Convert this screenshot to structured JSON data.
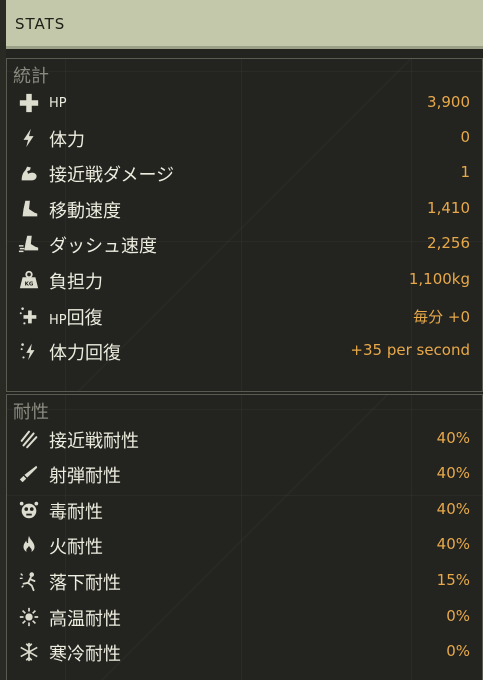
{
  "header": {
    "title": "STATS"
  },
  "sections": [
    {
      "title": "統計",
      "rows": [
        {
          "icon": "plus-icon",
          "label_prefix": "HP",
          "label": "",
          "value": "3,900"
        },
        {
          "icon": "lightning-icon",
          "label_prefix": "",
          "label": "体力",
          "value": "0"
        },
        {
          "icon": "bicep-icon",
          "label_prefix": "",
          "label": "接近戦ダメージ",
          "value": "1"
        },
        {
          "icon": "boot-icon",
          "label_prefix": "",
          "label": "移動速度",
          "value": "1,410"
        },
        {
          "icon": "dash-boot-icon",
          "label_prefix": "",
          "label": "ダッシュ速度",
          "value": "2,256"
        },
        {
          "icon": "weight-icon",
          "label_prefix": "",
          "label": "負担力",
          "value": "1,100kg"
        },
        {
          "icon": "hp-regen-icon",
          "label_prefix": "HP",
          "label": "回復",
          "value": "毎分 +0"
        },
        {
          "icon": "stamina-regen-icon",
          "label_prefix": "",
          "label": "体力回復",
          "value": "+35 per second"
        }
      ]
    },
    {
      "title": "耐性",
      "rows": [
        {
          "icon": "claw-icon",
          "label_prefix": "",
          "label": "接近戦耐性",
          "value": "40%"
        },
        {
          "icon": "bullet-icon",
          "label_prefix": "",
          "label": "射弾耐性",
          "value": "40%"
        },
        {
          "icon": "poison-icon",
          "label_prefix": "",
          "label": "毒耐性",
          "value": "40%"
        },
        {
          "icon": "fire-icon",
          "label_prefix": "",
          "label": "火耐性",
          "value": "40%"
        },
        {
          "icon": "fall-icon",
          "label_prefix": "",
          "label": "落下耐性",
          "value": "15%"
        },
        {
          "icon": "sun-icon",
          "label_prefix": "",
          "label": "高温耐性",
          "value": "0%"
        },
        {
          "icon": "snowflake-icon",
          "label_prefix": "",
          "label": "寒冷耐性",
          "value": "0%"
        }
      ]
    }
  ]
}
